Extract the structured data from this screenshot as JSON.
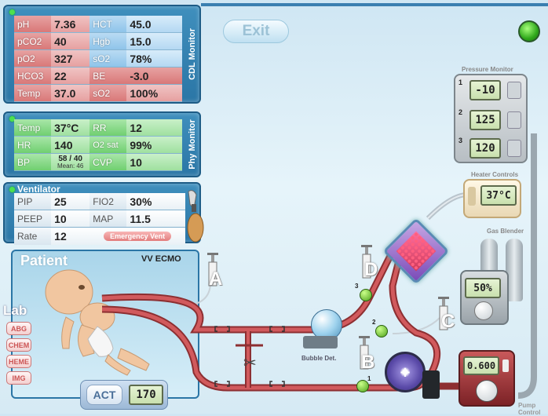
{
  "cdl_monitor": {
    "title": "CDL Monitor",
    "rows": [
      {
        "l1": "pH",
        "v1": "7.36",
        "l2": "HCT",
        "v2": "45.0"
      },
      {
        "l1": "pCO2",
        "v1": "40",
        "l2": "Hgb",
        "v2": "15.0"
      },
      {
        "l1": "pO2",
        "v1": "327",
        "l2": "sO2",
        "v2": "78%"
      },
      {
        "l1": "HCO3",
        "v1": "22",
        "l2": "BE",
        "v2": "-3.0"
      },
      {
        "l1": "Temp",
        "v1": "37.0",
        "l2": "sO2",
        "v2": "100%"
      }
    ]
  },
  "phy_monitor": {
    "title": "Phy Monitor",
    "temp_label": "Temp",
    "temp_value": "37°C",
    "rr_label": "RR",
    "rr_value": "12",
    "hr_label": "HR",
    "hr_value": "140",
    "o2sat_label": "O2 sat",
    "o2sat_value": "99%",
    "bp_label": "BP",
    "bp_value": "58 / 40",
    "bp_mean": "Mean: 46",
    "cvp_label": "CVP",
    "cvp_value": "10"
  },
  "ventilator": {
    "title": "Ventilator",
    "pip_label": "PIP",
    "pip_value": "25",
    "fio2_label": "FIO2",
    "fio2_value": "30%",
    "peep_label": "PEEP",
    "peep_value": "10",
    "map_label": "MAP",
    "map_value": "11.5",
    "rate_label": "Rate",
    "rate_value": "12",
    "emergency_label": "Emergency Vent"
  },
  "patient": {
    "label": "Patient",
    "mode": "VV ECMO"
  },
  "lab": {
    "title": "Lab",
    "buttons": [
      "ABG",
      "CHEM",
      "HEME",
      "IMG"
    ]
  },
  "act": {
    "button_label": "ACT",
    "value": "170"
  },
  "header": {
    "exit_label": "Exit"
  },
  "pressure_monitor": {
    "title": "Pressure Monitor",
    "readings": [
      {
        "index": "1",
        "value": "-10"
      },
      {
        "index": "2",
        "value": "125"
      },
      {
        "index": "3",
        "value": "120"
      }
    ]
  },
  "heater": {
    "title": "Heater Controls",
    "value": "37°C"
  },
  "gas_blender": {
    "title": "Gas Blender",
    "value": "50%"
  },
  "pump": {
    "value": "0.600",
    "caption": "Pump Control"
  },
  "circuit": {
    "bubble_detector_label": "Bubble Det.",
    "access_points": [
      "A",
      "B",
      "C",
      "D"
    ],
    "port_numbers": [
      "1",
      "2",
      "3"
    ]
  },
  "colors": {
    "panel_blue": "#2b76a6",
    "tube_red": "#c2474a",
    "status_green": "#2fa81b"
  }
}
